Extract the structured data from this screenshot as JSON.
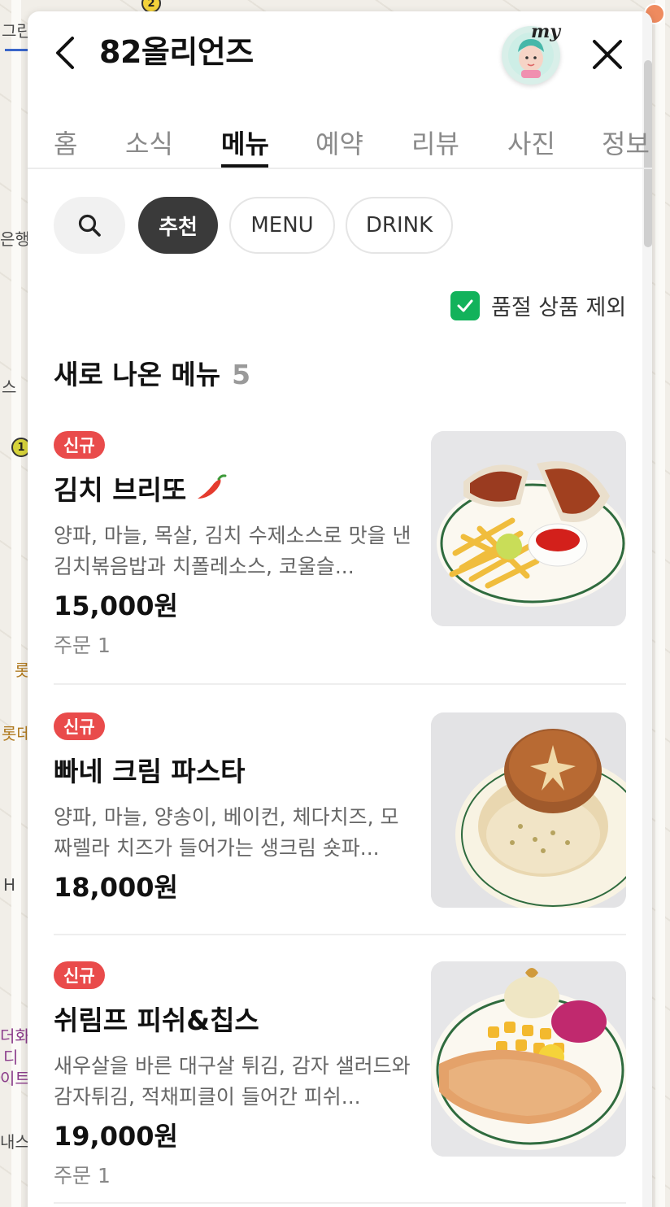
{
  "map": {
    "labels": [
      "그린",
      "은행",
      "스",
      "롯",
      "롯데",
      "H",
      "더화",
      "디",
      "이트",
      "내스"
    ],
    "badge_2": "2",
    "badge_1": "1"
  },
  "header": {
    "title": "82올리언즈",
    "avatar_text": "my"
  },
  "tabs": [
    {
      "label": "홈"
    },
    {
      "label": "소식"
    },
    {
      "label": "메뉴"
    },
    {
      "label": "예약"
    },
    {
      "label": "리뷰"
    },
    {
      "label": "사진"
    },
    {
      "label": "정보"
    }
  ],
  "chips": {
    "recommended": "추천",
    "menu": "MENU",
    "drink": "DRINK"
  },
  "filter": {
    "exclude_soldout_label": "품절 상품 제외",
    "checked": true
  },
  "section": {
    "title": "새로 나온 메뉴",
    "count": "5"
  },
  "items": [
    {
      "badge": "신규",
      "name": "김치 브리또",
      "desc": "양파, 마늘, 목살, 김치 수제소스로 맛을 낸 김치볶음밥과 치폴레소스, 코울슬...",
      "price": "15,000원",
      "orders": "주문 1",
      "photo_icon": "burrito-plate-photo"
    },
    {
      "badge": "신규",
      "name": "빠네 크림 파스타",
      "desc": "양파, 마늘, 양송이, 베이컨, 체다치즈, 모짜렐라 치즈가 들어가는 생크림 숏파...",
      "price": "18,000원",
      "orders": "",
      "photo_icon": "bread-bowl-pasta-photo"
    },
    {
      "badge": "신규",
      "name": "쉬림프 피쉬&칩스",
      "desc": "새우살을 바른 대구살 튀김, 감자 샐러드와 감자튀김, 적채피클이 들어간 피쉬...",
      "price": "19,000원",
      "orders": "주문 1",
      "photo_icon": "fish-and-chips-photo"
    }
  ],
  "colors": {
    "accent_red": "#e94b4b",
    "check_green": "#12b25b",
    "chip_dark": "#3a3a3a"
  }
}
